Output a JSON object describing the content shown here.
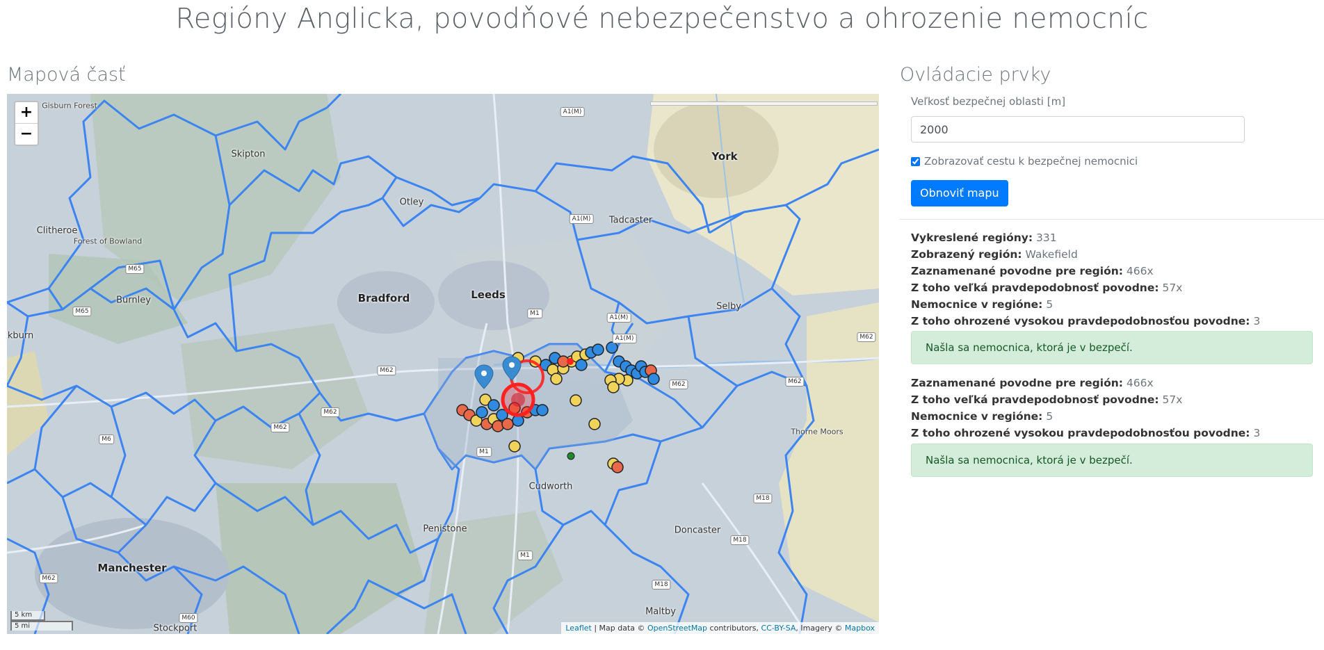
{
  "page": {
    "title": "Regióny Anglicka, povodňové nebezpečenstvo a ohrozenie nemocníc"
  },
  "map_section": {
    "title": "Mapová časť",
    "zoom_in": "+",
    "zoom_out": "−",
    "places": [
      {
        "name": "Gisburn Forest",
        "kind": "small"
      },
      {
        "name": "Skipton",
        "kind": "normal"
      },
      {
        "name": "York",
        "kind": "big"
      },
      {
        "name": "Otley",
        "kind": "normal"
      },
      {
        "name": "Tadcaster",
        "kind": "normal"
      },
      {
        "name": "Clitheroe",
        "kind": "normal"
      },
      {
        "name": "Forest of Bowland",
        "kind": "small"
      },
      {
        "name": "Burnley",
        "kind": "normal"
      },
      {
        "name": "Bradford",
        "kind": "big"
      },
      {
        "name": "Leeds",
        "kind": "big"
      },
      {
        "name": "Selby",
        "kind": "normal"
      },
      {
        "name": "ckburn",
        "kind": "normal"
      },
      {
        "name": "Thorne Moors",
        "kind": "small"
      },
      {
        "name": "Cudworth",
        "kind": "normal"
      },
      {
        "name": "Penistone",
        "kind": "normal"
      },
      {
        "name": "Doncaster",
        "kind": "normal"
      },
      {
        "name": "Manchester",
        "kind": "big"
      },
      {
        "name": "Maltby",
        "kind": "normal"
      },
      {
        "name": "Stockport",
        "kind": "normal"
      }
    ],
    "roads": [
      "A1(M)",
      "A1(M)",
      "M65",
      "M65",
      "M1",
      "A1(M)",
      "A1(M)",
      "M62",
      "M62",
      "M62",
      "M62",
      "M62",
      "M62",
      "M6",
      "M1",
      "M18",
      "M18",
      "M1",
      "M18",
      "M62",
      "M60"
    ],
    "scale_km": "5 km",
    "scale_mi": "5 mi",
    "attribution": {
      "leaflet": "Leaflet",
      "sep1": " | Map data © ",
      "osm": "OpenStreetMap",
      "sep2": " contributors, ",
      "license": "CC-BY-SA",
      "sep3": ", Imagery © ",
      "mapbox": "Mapbox"
    },
    "colors": {
      "region_border": "#3c84f0",
      "flood_high": "#e8694a",
      "flood_medium": "#f0d35a",
      "flood_low": "#2f8ae0",
      "hospital_danger": "#ff2020",
      "marker": "#3b8bd1"
    }
  },
  "controls": {
    "title": "Ovládacie prvky",
    "safe_area_label": "Veľkosť bezpečnej oblasti [m]",
    "safe_area_value": "2000",
    "show_path_label": "Zobrazovať cestu k bezpečnej nemocnici",
    "show_path_checked": true,
    "refresh_button": "Obnoviť mapu"
  },
  "stats": {
    "drawn_regions_label": "Vykreslené regióny:",
    "drawn_regions_value": "331",
    "shown_region_label": "Zobrazený región:",
    "shown_region_value": "Wakefield",
    "block1": {
      "floods_label": "Zaznamenané povodne pre región:",
      "floods_value": "466x",
      "high_prob_label": "Z toho veľká pravdepodobnosť povodne:",
      "high_prob_value": "57x",
      "hospitals_label": "Nemocnice v regióne:",
      "hospitals_value": "5",
      "threatened_label": "Z toho ohrozené vysokou pravdepodobnosťou povodne:",
      "threatened_value": "3",
      "alert": "Našla sa nemocnica, ktorá je v bezpečí."
    },
    "block2": {
      "floods_label": "Zaznamenané povodne pre región:",
      "floods_value": "466x",
      "high_prob_label": "Z toho veľká pravdepodobnosť povodne:",
      "high_prob_value": "57x",
      "hospitals_label": "Nemocnice v regióne:",
      "hospitals_value": "5",
      "threatened_label": "Z toho ohrozené vysokou pravdepodobnosťou povodne:",
      "threatened_value": "3",
      "alert": "Našla sa nemocnica, ktorá je v bezpečí."
    }
  }
}
